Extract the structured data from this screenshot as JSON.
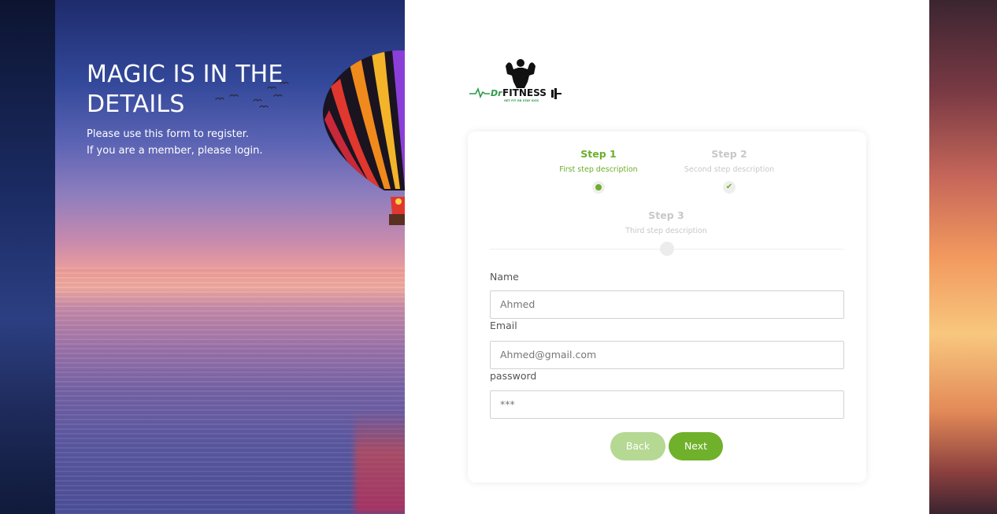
{
  "hero": {
    "title": "MAGIC IS IN THE DETAILS",
    "line1": "Please use this form to register.",
    "line2": "If you are a member, please login."
  },
  "logo": {
    "brand_prefix": "Dr",
    "brand_name": "FITNESS",
    "tagline": "GET FIT OR STAY SICK"
  },
  "steps": [
    {
      "title": "Step 1",
      "description": "First step description",
      "state": "active"
    },
    {
      "title": "Step 2",
      "description": "Second step description",
      "state": "complete"
    },
    {
      "title": "Step 3",
      "description": "Third step description",
      "state": "pending"
    }
  ],
  "form": {
    "name_label": "Name",
    "name_value": "Ahmed",
    "email_label": "Email",
    "email_value": "Ahmed@gmail.com",
    "password_label": "password",
    "password_value": "***"
  },
  "buttons": {
    "back": "Back",
    "next": "Next"
  },
  "colors": {
    "accent": "#6fb12b",
    "accent_light": "#b5d893",
    "inactive": "#c8c8c8"
  }
}
